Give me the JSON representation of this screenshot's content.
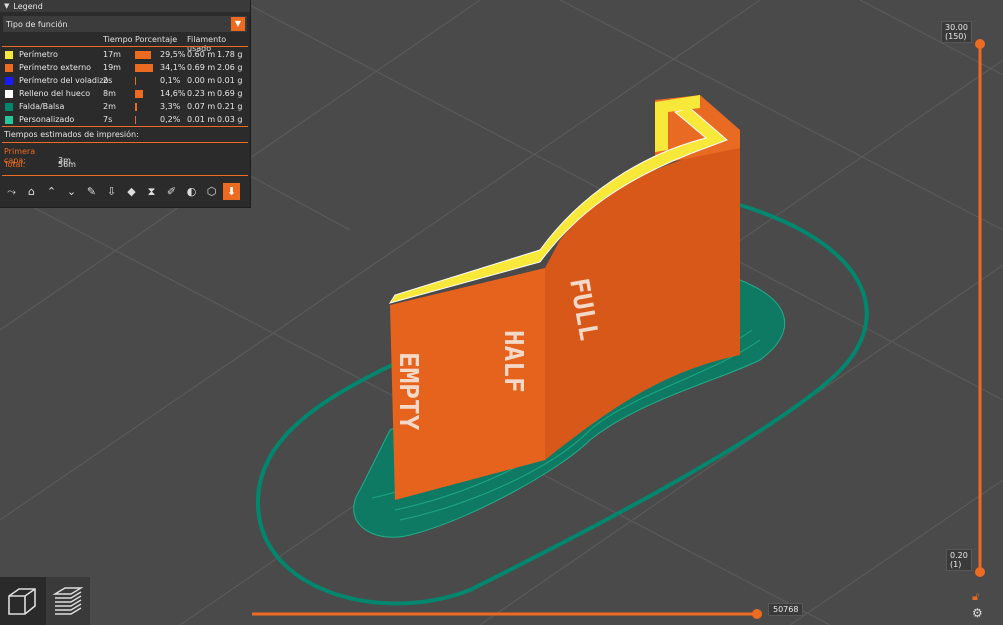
{
  "legend": {
    "title": "Legend",
    "feature_type": "Tipo de función",
    "columns": {
      "time": "Tiempo",
      "percentage": "Porcentaje",
      "filament": "Filamento usado"
    },
    "rows": [
      {
        "name": "Perímetro",
        "time": "17m",
        "percent": "29,5%",
        "meters": "0.60 m",
        "grams": "1.78 g",
        "color": "#f7e83a",
        "fraction": 0.295
      },
      {
        "name": "Perímetro externo",
        "time": "19m",
        "percent": "34,1%",
        "meters": "0.69 m",
        "grams": "2.06 g",
        "color": "#ed6b21",
        "fraction": 0.341
      },
      {
        "name": "Perímetro del voladizo",
        "time": "2s",
        "percent": "0,1%",
        "meters": "0.00 m",
        "grams": "0.01 g",
        "color": "#1a1aff",
        "fraction": 0.001
      },
      {
        "name": "Relleno del hueco",
        "time": "8m",
        "percent": "14,6%",
        "meters": "0.23 m",
        "grams": "0.69 g",
        "color": "#ffffff",
        "fraction": 0.146
      },
      {
        "name": "Falda/Balsa",
        "time": "2m",
        "percent": "3,3%",
        "meters": "0.07 m",
        "grams": "0.21 g",
        "color": "#00876e",
        "fraction": 0.033
      },
      {
        "name": "Personalizado",
        "time": "7s",
        "percent": "0,2%",
        "meters": "0.01 m",
        "grams": "0.03 g",
        "color": "#27c59a",
        "fraction": 0.002
      }
    ],
    "estimated_label": "Tiempos estimados de impresión:",
    "first_layer_label": "Primera capa:",
    "first_layer_value": "3m",
    "total_label": "Total:",
    "total_value": "56m",
    "toolbar_icons": [
      "travel-icon",
      "wipe-icon",
      "retractions-icon",
      "deretractions-icon",
      "seams-icon",
      "tool-changes-icon",
      "color-changes-icon",
      "pause-icon",
      "custom-gcode-icon",
      "center-of-gravity-icon",
      "shells-icon",
      "tool-marker-icon"
    ]
  },
  "layer_slider": {
    "top_height": "30.00",
    "top_layer": "(150)",
    "bottom_height": "0.20",
    "bottom_layer": "(1)"
  },
  "move_slider": {
    "value": "50768"
  },
  "view": {
    "buttons": [
      "3d-view-icon",
      "layers-view-icon"
    ],
    "model_text": [
      "EMPTY",
      "HALF",
      "FULL"
    ]
  },
  "colors": {
    "accent": "#ed6b21",
    "background": "#4a4a4a",
    "skirt": "#00876e",
    "model": "#e5631c"
  }
}
